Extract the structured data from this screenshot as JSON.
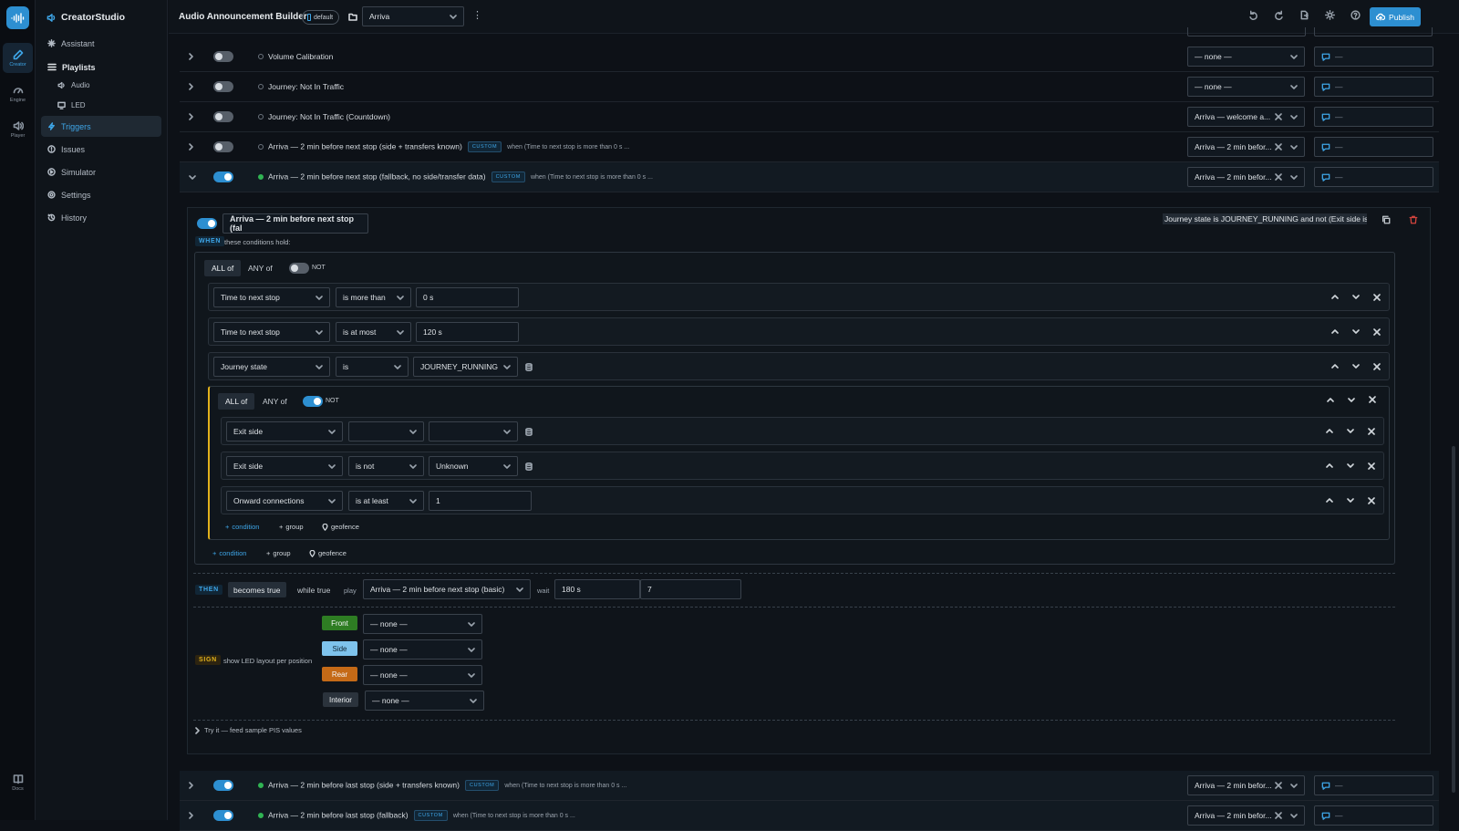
{
  "app": {
    "name": "CreatorStudio"
  },
  "rail": [
    {
      "label": "Creator",
      "icon": "pencil-icon",
      "active": true
    },
    {
      "label": "Engine",
      "icon": "gauge-icon",
      "active": false
    },
    {
      "label": "Player",
      "icon": "speaker-icon",
      "active": false
    },
    {
      "label": "Docs",
      "icon": "book-icon",
      "active": false
    }
  ],
  "sidebar": {
    "assistant": "Assistant",
    "playlists": "Playlists",
    "audio": "Audio",
    "led": "LED",
    "triggers": "Triggers",
    "issues": "Issues",
    "simulator": "Simulator",
    "settings": "Settings",
    "history": "History"
  },
  "header": {
    "title": "Audio Announcement Builder",
    "badge": "default",
    "operator": "Arriva",
    "publish": "Publish"
  },
  "rows": [
    {
      "name": "Volume Calibration",
      "enabled": false,
      "active": false,
      "badge": "",
      "when": "",
      "sel": "— none —",
      "clear": false,
      "msg": "—"
    },
    {
      "name": "Journey: Not In Traffic",
      "enabled": false,
      "active": false,
      "badge": "",
      "when": "",
      "sel": "— none —",
      "clear": false,
      "msg": "—"
    },
    {
      "name": "Journey: Not In Traffic (Countdown)",
      "enabled": false,
      "active": false,
      "badge": "",
      "when": "",
      "sel": "Arriva — welcome a...",
      "clear": true,
      "msg": "—"
    },
    {
      "name": "Arriva — 2 min before next stop (side + transfers known)",
      "enabled": false,
      "active": false,
      "badge": "CUSTOM",
      "when": "when (Time to next stop is more than 0 s ...",
      "sel": "Arriva — 2 min befor...",
      "clear": true,
      "msg": "—"
    },
    {
      "name": "Arriva — 2 min before next stop (fallback, no side/transfer data)",
      "enabled": true,
      "active": true,
      "badge": "CUSTOM",
      "when": "when (Time to next stop is more than 0 s ...",
      "sel": "Arriva — 2 min befor...",
      "clear": true,
      "msg": "—"
    }
  ],
  "bottom_rows": [
    {
      "name": "Arriva — 2 min before last stop (side + transfers known)",
      "enabled": true,
      "active": true,
      "badge": "CUSTOM",
      "when": "when (Time to next stop is more than 0 s ...",
      "sel": "Arriva — 2 min befor...",
      "clear": true,
      "msg": "—"
    },
    {
      "name": "Arriva — 2 min before last stop (fallback)",
      "enabled": true,
      "active": true,
      "badge": "CUSTOM",
      "when": "when (Time to next stop is more than 0 s ...",
      "sel": "Arriva — 2 min befor...",
      "clear": true,
      "msg": "—"
    }
  ],
  "editor": {
    "name": "Arriva — 2 min before next stop (fal",
    "summary": "Journey state is JOURNEY_RUNNING and not (Exit side is",
    "when_label": "WHEN",
    "when_text": "these conditions hold:",
    "all_of": "ALL of",
    "any_of": "ANY of",
    "not": "NOT",
    "conditions": [
      {
        "field": "Time to next stop",
        "op": "is more than",
        "value": "0 s",
        "db": false
      },
      {
        "field": "Time to next stop",
        "op": "is at most",
        "value": "120 s",
        "db": false
      },
      {
        "field": "Journey state",
        "op": "is",
        "value": "JOURNEY_RUNNING",
        "db": true
      }
    ],
    "nested": [
      {
        "field": "Exit side",
        "op": "",
        "value": "",
        "db": true
      },
      {
        "field": "Exit side",
        "op": "is not",
        "value": "Unknown",
        "db": true
      },
      {
        "field": "Onward connections",
        "op": "is at least",
        "value": "1",
        "db": false
      }
    ],
    "add_condition": "condition",
    "add_group": "group",
    "add_geofence": "geofence",
    "then_label": "THEN",
    "becomes_true": "becomes true",
    "while_true": "while true",
    "play": "play",
    "play_value": "Arriva — 2 min before next stop (basic)",
    "wait": "wait",
    "wait_value": "180 s",
    "repeat_value": "7",
    "sign_label": "SIGN",
    "sign_text": "show LED layout per position",
    "positions": [
      {
        "label": "Front",
        "value": "— none —",
        "color": "#2e7d23"
      },
      {
        "label": "Side",
        "value": "— none —",
        "color": "#7ec3ec"
      },
      {
        "label": "Rear",
        "value": "— none —",
        "color": "#c56a17"
      },
      {
        "label": "Interior",
        "value": "— none —",
        "color": "#2b333c"
      }
    ],
    "try_it": "Try it — feed sample PIS values"
  },
  "colors": {
    "accent": "#2d8fd1",
    "active_dot": "#30b453",
    "nested_border": "#e2b21c",
    "delete": "#d0433d"
  }
}
